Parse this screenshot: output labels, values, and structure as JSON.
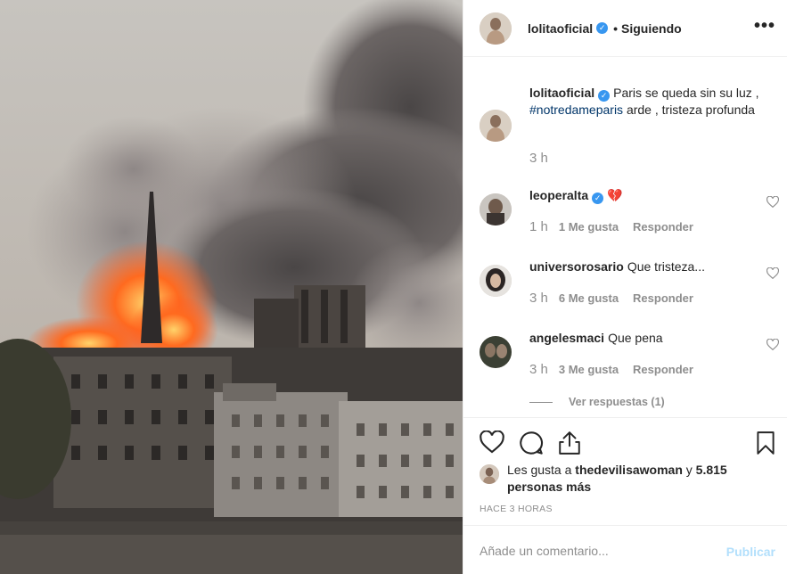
{
  "post": {
    "image_alt": "",
    "author": {
      "username": "lolitaoficial",
      "verified": true
    },
    "header": {
      "separator": "•",
      "follow_label": "Siguiendo",
      "more_label": "•••"
    },
    "caption": {
      "username": "lolitaoficial",
      "text_before": "Paris se queda sin su luz , ",
      "hashtag": "#notredameparis",
      "text_after": " arde , tristeza profunda",
      "time": "3 h"
    },
    "comments": [
      {
        "username": "leoperalta",
        "verified": true,
        "text": "💔",
        "time": "1 h",
        "likes": "1 Me gusta",
        "reply_label": "Responder"
      },
      {
        "username": "universorosario",
        "verified": false,
        "text": "Que tristeza...",
        "time": "3 h",
        "likes": "6 Me gusta",
        "reply_label": "Responder"
      },
      {
        "username": "angelesmaci",
        "verified": false,
        "text": "Que pena",
        "time": "3 h",
        "likes": "3 Me gusta",
        "reply_label": "Responder",
        "view_replies": "Ver respuestas (1)"
      }
    ],
    "actions": {
      "like_icon": "heart-icon",
      "comment_icon": "comment-icon",
      "share_icon": "share-icon",
      "save_icon": "bookmark-icon"
    },
    "likes_summary": {
      "prefix": "Les gusta a ",
      "username": "thedevilisawoman",
      "middle": " y ",
      "count": "5.815 personas más"
    },
    "time_ago": "HACE 3 HORAS",
    "comment_form": {
      "placeholder": "Añade un comentario...",
      "submit_label": "Publicar"
    },
    "colors": {
      "link_blue": "#003569",
      "verified_blue": "#3897f0",
      "muted": "#8e8e8e",
      "publish_disabled": "#b2dffc",
      "fire": "#ff5a1f"
    }
  }
}
